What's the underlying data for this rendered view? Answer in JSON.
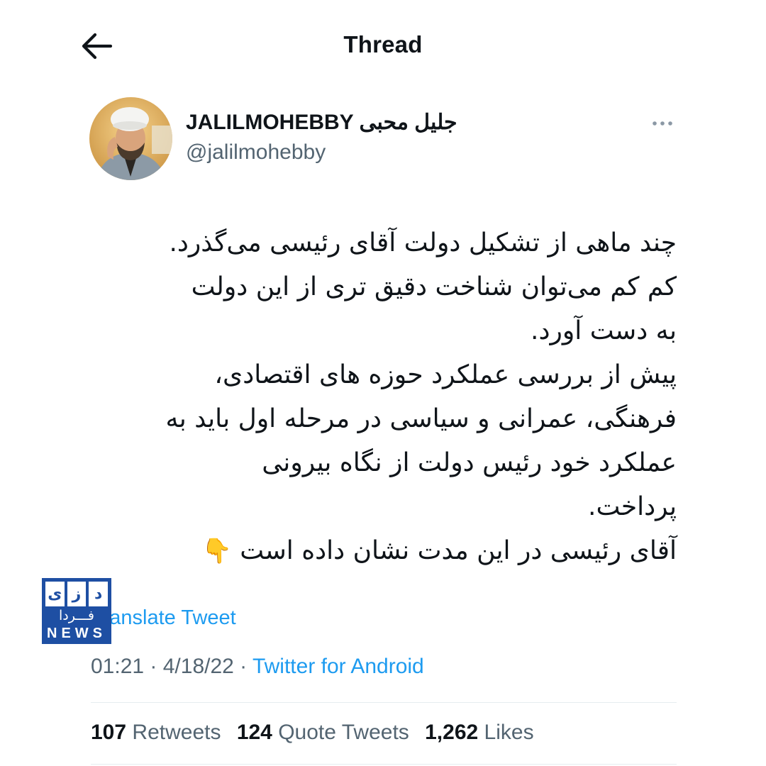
{
  "header": {
    "title": "Thread",
    "back_icon": "arrow-left-icon"
  },
  "author": {
    "display_name": "JALILMOHEBBY جلیل محبی",
    "handle": "@jalilmohebby",
    "more_icon": "more-horizontal-icon"
  },
  "tweet": {
    "lines": [
      "چند ماهی از تشکیل دولت آقای رئیسی می‌گذرد.",
      "کم کم می‌توان شناخت دقیق تری از این دولت",
      "به دست آورد.",
      "پیش از بررسی عملکرد حوزه های اقتصادی،",
      "فرهنگی، عمرانی و سیاسی در مرحله اول باید به",
      "عملکرد خود رئیس دولت از نگاه بیرونی",
      "پرداخت.",
      "آقای رئیسی در این مدت نشان داده است"
    ],
    "emoji": "👇",
    "translate_label": "Translate Tweet"
  },
  "meta": {
    "time": "01:21",
    "separator": " · ",
    "date": "4/18/22",
    "source": "Twitter for Android"
  },
  "stats": {
    "retweets_count": "107",
    "retweets_label": "Retweets",
    "quotes_count": "124",
    "quotes_label": "Quote Tweets",
    "likes_count": "1,262",
    "likes_label": "Likes"
  },
  "watermark": {
    "letters": [
      "ی",
      "ز",
      "د"
    ],
    "subtitle": "فـــردا",
    "word": "NEWS"
  },
  "colors": {
    "text": "#0f1419",
    "secondary": "#536471",
    "link": "#1d9bf0",
    "divider": "#e6ecf0",
    "watermark": "#1e4fa3"
  }
}
